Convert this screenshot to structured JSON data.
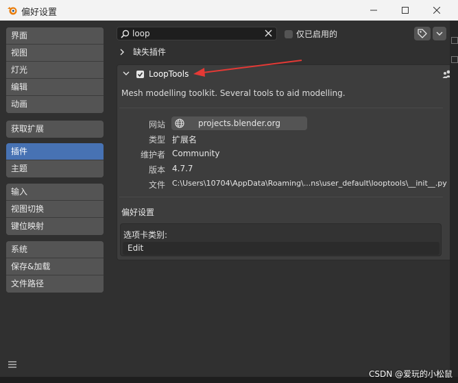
{
  "window": {
    "title": "偏好设置",
    "icon": "blender-logo-icon",
    "accent": "#4772b3"
  },
  "sidebar": {
    "groups": [
      [
        "界面",
        "视图",
        "灯光",
        "编辑",
        "动画"
      ],
      [
        "获取扩展"
      ],
      [
        "插件",
        "主题"
      ],
      [
        "输入",
        "视图切换",
        "键位映射"
      ],
      [
        "系统",
        "保存&加载",
        "文件路径"
      ]
    ],
    "active": "插件"
  },
  "search": {
    "value": "loop",
    "placeholder": ""
  },
  "filter": {
    "enabled_only_label": "仅已启用的",
    "enabled_only_checked": false
  },
  "missing": {
    "label": "缺失插件"
  },
  "addon": {
    "name": "LoopTools",
    "enabled": true,
    "description": "Mesh modelling toolkit. Several tools to aid modelling.",
    "website_label": "网站",
    "website": "projects.blender.org",
    "type_label": "类型",
    "type": "扩展名",
    "maintainer_label": "维护者",
    "maintainer": "Community",
    "version_label": "版本",
    "version": "4.7.7",
    "file_label": "文件",
    "file": "C:\\Users\\10704\\AppData\\Roaming\\...ns\\user_default\\looptools\\__init__.py",
    "prefs_title": "偏好设置",
    "tab_category_label": "选项卡类别:",
    "tab_category": "Edit"
  },
  "watermark": "CSDN @爱玩的小松鼠"
}
